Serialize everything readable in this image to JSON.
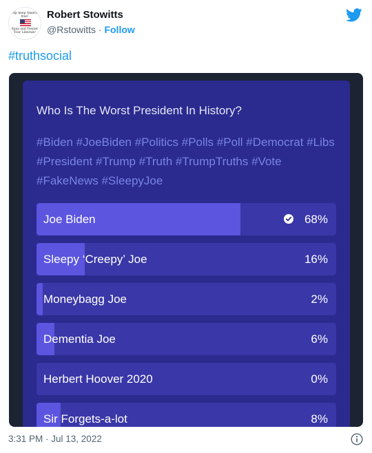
{
  "author": {
    "name": "Robert Stowitts",
    "handle": "@Rstowitts",
    "separator": "·",
    "follow_label": "Follow",
    "avatar_text_top": "Help keep America free!",
    "avatar_text_bottom": "Spay and Neuter Your Liberals!"
  },
  "tweet": {
    "hashtag": "#truthsocial",
    "timestamp": "3:31 PM · Jul 13, 2022"
  },
  "poll": {
    "question": "Who Is The Worst President In History?",
    "tags": "#Biden #JoeBiden #Politics #Polls #Poll #Democrat #Libs #President #Trump #Truth #TrumpTruths #Vote #FakeNews #SleepyJoe",
    "options": [
      {
        "label": "Joe Biden",
        "percent": "68%",
        "value": 68,
        "selected": true
      },
      {
        "label": "Sleepy ‘Creepy’ Joe",
        "percent": "16%",
        "value": 16
      },
      {
        "label": "Moneybagg Joe",
        "percent": "2%",
        "value": 2
      },
      {
        "label": "Dementia Joe",
        "percent": "6%",
        "value": 6
      },
      {
        "label": "Herbert Hoover 2020",
        "percent": "0%",
        "value": 0
      },
      {
        "label": "Sir Forgets-a-lot",
        "percent": "8%",
        "value": 8
      }
    ]
  },
  "icons": {
    "brand": "twitter-bird-icon",
    "selected": "check-circle-icon",
    "info": "info-icon"
  },
  "colors": {
    "twitter_blue": "#1d9bf0",
    "poll_background": "#2b2a8e",
    "poll_option": "#3a37a8",
    "poll_fill": "#5b55df",
    "tag_color": "#7a84e6"
  }
}
